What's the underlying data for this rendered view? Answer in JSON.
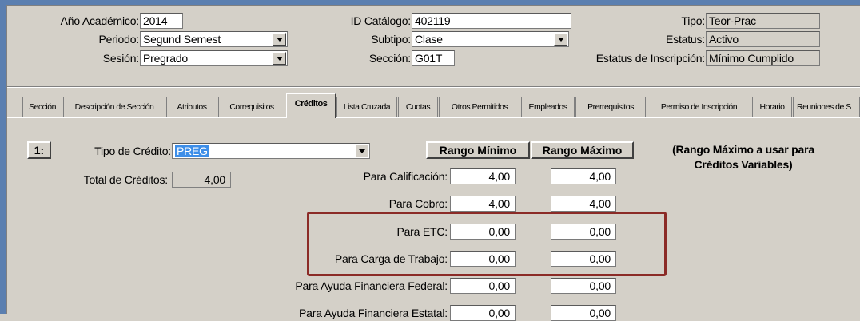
{
  "header": {
    "ano_label": "Año Académico:",
    "ano_value": "2014",
    "periodo_label": "Periodo:",
    "periodo_value": "Segund Semest",
    "sesion_label": "Sesión:",
    "sesion_value": "Pregrado",
    "catalogo_label": "ID Catálogo:",
    "catalogo_value": "402119",
    "subtipo_label": "Subtipo:",
    "subtipo_value": "Clase",
    "seccion_label": "Sección:",
    "seccion_value": "G01T",
    "tipo_label": "Tipo:",
    "tipo_value": "Teor-Prac",
    "estatus_label": "Estatus:",
    "estatus_value": "Activo",
    "inscripcion_label": "Estatus de Inscripción:",
    "inscripcion_value": "Mínimo Cumplido"
  },
  "tabs": [
    {
      "label": "Sección"
    },
    {
      "label": "Descripción de Sección"
    },
    {
      "label": "Atributos"
    },
    {
      "label": "Correquisitos"
    },
    {
      "label": "Créditos"
    },
    {
      "label": "Lista Cruzada"
    },
    {
      "label": "Cuotas"
    },
    {
      "label": "Otros Permitidos"
    },
    {
      "label": "Empleados"
    },
    {
      "label": "Prerrequisitos"
    },
    {
      "label": "Permiso de Inscripción"
    },
    {
      "label": "Horario"
    },
    {
      "label": "Reuniones de S"
    }
  ],
  "credits": {
    "row_number": "1:",
    "tipo_label": "Tipo de Crédito:",
    "tipo_value": "PREG",
    "total_label": "Total de Créditos:",
    "total_value": "4,00",
    "min_header": "Rango Mínimo",
    "max_header": "Rango Máximo",
    "note": "(Rango Máximo a usar para\nCréditos Variables)",
    "rows": [
      {
        "label": "Para Calificación:",
        "min": "4,00",
        "max": "4,00"
      },
      {
        "label": "Para Cobro:",
        "min": "4,00",
        "max": "4,00"
      },
      {
        "label": "Para ETC:",
        "min": "0,00",
        "max": "0,00"
      },
      {
        "label": "Para Carga de Trabajo:",
        "min": "0,00",
        "max": "0,00"
      },
      {
        "label": "Para Ayuda Financiera Federal:",
        "min": "0,00",
        "max": "0,00"
      },
      {
        "label": "Para Ayuda Financiera Estatal:",
        "min": "0,00",
        "max": "0,00"
      }
    ]
  },
  "colors": {
    "highlight": "#8b2b27",
    "selection": "#3d8ee8",
    "frame": "#5b7fb0"
  }
}
